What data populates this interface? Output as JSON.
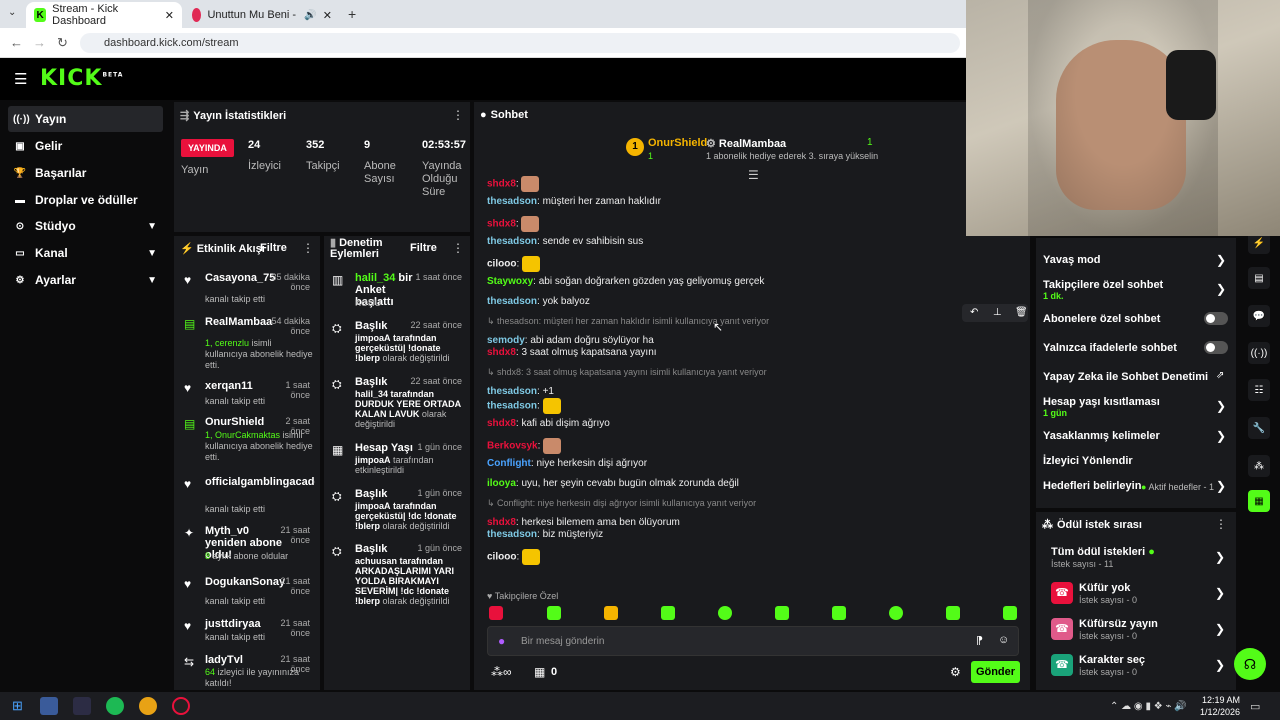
{
  "browser": {
    "tabs": [
      {
        "label": "Stream - Kick Dashboard"
      },
      {
        "label": "Unuttun Mu Beni - YouTube"
      }
    ],
    "url": "dashboard.kick.com/stream"
  },
  "brand": {
    "logo": "KICK",
    "sup": "BETA",
    "accent": "#53fc18"
  },
  "sidebar": {
    "items": [
      {
        "label": "Yayın",
        "icon": "broadcast-icon"
      },
      {
        "label": "Gelir",
        "icon": "revenue-icon"
      },
      {
        "label": "Başarılar",
        "icon": "trophy-icon"
      },
      {
        "label": "Droplar ve ödüller",
        "icon": "gift-icon"
      },
      {
        "label": "Stüdyo",
        "icon": "studio-icon"
      },
      {
        "label": "Kanal",
        "icon": "channel-icon"
      },
      {
        "label": "Ayarlar",
        "icon": "gear-icon"
      }
    ]
  },
  "stats": {
    "title": "Yayın İstatistikleri",
    "live_badge": "YAYINDA",
    "live_label": "Yayın",
    "viewers_value": "24",
    "viewers_label": "İzleyici",
    "followers_value": "352",
    "followers_label": "Takipçi",
    "subs_value": "9",
    "subs_label": "Abone Sayısı",
    "duration_value": "02:53:57",
    "duration_label": "Yayında Olduğu Süre"
  },
  "activity": {
    "title": "Etkinlik Akışı",
    "filter": "Filtre",
    "items": [
      {
        "name": "Casayona_75",
        "time": "35 dakika önce",
        "desc": "kanalı takip etti",
        "desc_green": ""
      },
      {
        "name": "RealMambaa",
        "time": "54 dakika önce",
        "desc_green": "1, cerenzlu",
        "desc": "isimli kullanıcıya abonelik hediye etti."
      },
      {
        "name": "xerqan11",
        "time": "1 saat önce",
        "desc": "kanalı takip etti",
        "desc_green": ""
      },
      {
        "name": "OnurShield",
        "time": "2 saat önce",
        "desc_green": "1, OnurCakmaktas",
        "desc": "isimli kullanıcıya abonelik hediye etti."
      },
      {
        "name": "officialgamblingacaden",
        "time": "",
        "desc": "kanalı takip etti",
        "desc_green": ""
      },
      {
        "name": "Myth_v0 yeniden abone oldu!",
        "time": "21 saat önce",
        "desc_green": "8",
        "desc": "aylık abone oldular"
      },
      {
        "name": "DogukanSonay",
        "time": "21 saat önce",
        "desc": "kanalı takip etti",
        "desc_green": ""
      },
      {
        "name": "justtdiryaa",
        "time": "21 saat önce",
        "desc": "kanalı takip etti",
        "desc_green": ""
      },
      {
        "name": "ladyTvl",
        "time": "21 saat önce",
        "desc_green": "64",
        "desc": "izleyici ile yayınınıza katıldı!"
      }
    ]
  },
  "moderation": {
    "title": "Denetim Eylemleri",
    "filter": "Filtre",
    "items": [
      {
        "name_green": "halil_34",
        "name": "bir Anket başlattı",
        "time": "1 saat önce",
        "desc_user": "",
        "desc": "KONU",
        "desc_tail": ""
      },
      {
        "name_green": "",
        "name": "Başlık",
        "time": "22 saat önce",
        "desc_user": "jimpoaA",
        "desc": "tarafından gerçeküstü| !donate !blerp",
        "desc_tail": "olarak değiştirildi"
      },
      {
        "name_green": "",
        "name": "Başlık",
        "time": "22 saat önce",
        "desc_user": "halil_34",
        "desc": "tarafından DURDUK YERE ORTADA KALAN LAVUK",
        "desc_tail": "olarak değiştirildi"
      },
      {
        "name_green": "",
        "name": "Hesap Yaşı",
        "time": "1 gün önce",
        "desc_user": "jimpoaA",
        "desc": "tarafından etkinleştirildi",
        "desc_tail": ""
      },
      {
        "name_green": "",
        "name": "Başlık",
        "time": "1 gün önce",
        "desc_user": "jimpoaA",
        "desc": "tarafından gerçeküstü| !dc !donate !blerp",
        "desc_tail": "olarak değiştirildi"
      },
      {
        "name_green": "",
        "name": "Başlık",
        "time": "1 gün önce",
        "desc_user": "achuusan",
        "desc": "tarafından ARKADAŞLARIMI YARI YOLDA BIRAKMAYI SEVERİM| !dc !donate !blerp",
        "desc_tail": "olarak değiştirildi"
      }
    ]
  },
  "chat": {
    "title": "Sohbet",
    "pinned_left_name": "OnurShield",
    "pinned_left_count": "1",
    "pinned_right_name": "RealMambaa",
    "pinned_right_count": "1",
    "pinned_right_desc": "1 abonelik hediye ederek 3. sıraya yükselin",
    "messages": [
      {
        "user": "shdx8",
        "text": "",
        "color": "#e9113c",
        "emote": true
      },
      {
        "user": "thesadson",
        "text": "müşteri her zaman haklıdır",
        "color": "#7ec8e3"
      },
      {
        "user": "shdx8",
        "text": "",
        "color": "#e9113c",
        "emote": true
      },
      {
        "user": "thesadson",
        "text": "sende ev sahibisin sus",
        "color": "#7ec8e3"
      },
      {
        "user": "cilooo",
        "text": "",
        "color": "#eee",
        "emote": true
      },
      {
        "user": "Staywoxy",
        "text": "abi soğan doğrarken gözden yaş geliyomuş gerçek",
        "color": "#53fc18"
      },
      {
        "user": "thesadson",
        "text": "yok balyoz",
        "color": "#7ec8e3"
      },
      {
        "reply": "thesadson: müşteri her zaman haklıdır isimli kullanıcıya yanıt veriyor"
      },
      {
        "user": "semody",
        "text": "abi adam doğru söylüyor ha",
        "color": "#7ec8e3"
      },
      {
        "user": "shdx8",
        "text": "3 saat olmuş kapatsana yayını",
        "color": "#e9113c"
      },
      {
        "reply": "shdx8: 3 saat olmuş kapatsana yayını isimli kullanıcıya yanıt veriyor"
      },
      {
        "user": "thesadson",
        "text": "+1",
        "color": "#7ec8e3"
      },
      {
        "user": "thesadson",
        "text": "",
        "color": "#7ec8e3",
        "emote": true
      },
      {
        "user": "shdx8",
        "text": "kafi abi dişim ağrıyo",
        "color": "#e9113c"
      },
      {
        "user": "Berkovsyk",
        "text": "",
        "color": "#e9113c",
        "emote": true
      },
      {
        "user": "Conflight",
        "text": "niye herkesin dişi ağrıyor",
        "color": "#4aa3ff"
      },
      {
        "user": "ilooya",
        "text": "uyu, her şeyin cevabı bugün olmak zorunda değil",
        "color": "#53fc18"
      },
      {
        "reply": "Conflight: niye herkesin dişi ağrıyor isimli kullanıcıya yanıt veriyor"
      },
      {
        "user": "shdx8",
        "text": "herkesi bilemem ama ben ölüyorum",
        "color": "#e9113c"
      },
      {
        "user": "thesadson",
        "text": "biz müşteriyiz",
        "color": "#7ec8e3"
      },
      {
        "user": "cilooo",
        "text": "",
        "color": "#eee",
        "emote": true
      }
    ],
    "followers_only": "Takipçilere Özel",
    "input_placeholder": "Bir mesaj gönderin",
    "points_value": "0",
    "send_label": "Gönder"
  },
  "chat_settings": {
    "items": [
      {
        "label": "Yavaş mod",
        "sub": "",
        "control": "chevron"
      },
      {
        "label": "Takipçilere özel sohbet",
        "sub": "1 dk.",
        "control": "chevron"
      },
      {
        "label": "Abonelere özel sohbet",
        "sub": "",
        "control": "toggle"
      },
      {
        "label": "Yalnızca ifadelerle sohbet",
        "sub": "",
        "control": "toggle"
      },
      {
        "label": "Yapay Zeka ile Sohbet Denetimi",
        "sub": "",
        "control": "external"
      },
      {
        "label": "Hesap yaşı kısıtlaması",
        "sub": "1 gün",
        "control": "chevron"
      },
      {
        "label": "Yasaklanmış kelimeler",
        "sub": "",
        "control": "chevron"
      },
      {
        "label": "İzleyici Yönlendir",
        "sub": "",
        "control": "none"
      },
      {
        "label": "Hedefleri belirleyin",
        "sub": "",
        "control": "chevron",
        "badge": "Aktif hedefler - 1"
      }
    ]
  },
  "rewards": {
    "title": "Ödül istek sırası",
    "all_label": "Tüm ödül istekleri",
    "all_sub": "İstek sayısı - 11",
    "items": [
      {
        "label": "Küfür yok",
        "sub": "İstek sayısı - 0",
        "color": "#e9113c"
      },
      {
        "label": "Küfürsüz yayın",
        "sub": "İstek sayısı - 0",
        "color": "#e05a8a"
      },
      {
        "label": "Karakter seç",
        "sub": "İstek sayısı - 0",
        "color": "#1aa37a"
      }
    ]
  },
  "taskbar": {
    "time": "12:19 AM",
    "date": "1/12/2026"
  }
}
